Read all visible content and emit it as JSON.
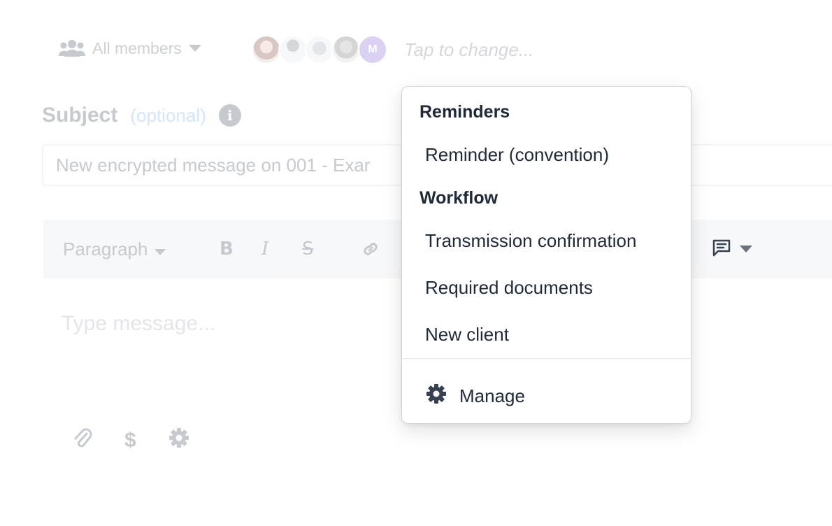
{
  "recipients": {
    "selector_label": "All members",
    "avatar_initial": "M",
    "placeholder": "Tap to change..."
  },
  "subject": {
    "label": "Subject",
    "optional_text": "(optional)",
    "info_glyph": "i",
    "value": "New encrypted message on 001 - Exar"
  },
  "toolbar": {
    "block_format": "Paragraph",
    "bold_glyph": "B",
    "italic_glyph": "I",
    "strike_glyph": "S"
  },
  "message": {
    "placeholder": "Type message..."
  },
  "footer": {
    "dollar_glyph": "$"
  },
  "template_menu": {
    "sections": [
      {
        "heading": "Reminders",
        "items": [
          "Reminder (convention)"
        ]
      },
      {
        "heading": "Workflow",
        "items": [
          "Transmission confirmation",
          "Required documents",
          "New client"
        ]
      }
    ],
    "manage_label": "Manage"
  },
  "icons": {
    "members": "users-icon",
    "caret": "caret-down-icon",
    "info": "info-icon",
    "link": "link-icon",
    "template": "message-template-icon",
    "attach": "paperclip-icon",
    "price": "dollar-icon",
    "settings": "gear-icon"
  },
  "colors": {
    "text": "#1f2937",
    "muted": "#9ca3af",
    "accent_optional": "#60a5fa",
    "avatar_purple": "#7c5cd6",
    "toolbar_bg": "#e5e7eb"
  }
}
